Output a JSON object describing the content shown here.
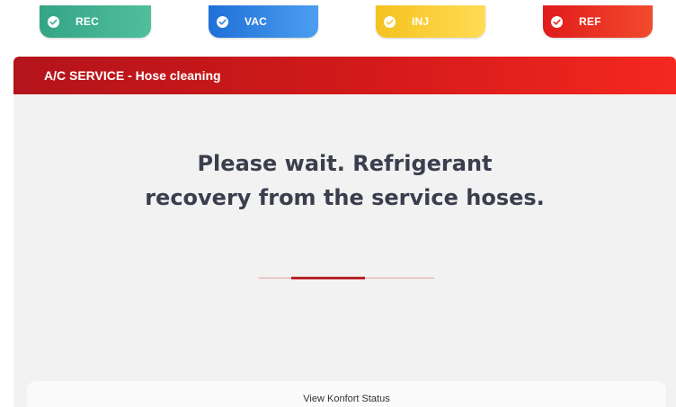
{
  "steps": [
    {
      "id": "rec",
      "label": "REC",
      "status": "completed",
      "color": "#3fae8e"
    },
    {
      "id": "vac",
      "label": "VAC",
      "status": "completed",
      "color": "#2f86e6"
    },
    {
      "id": "inj",
      "label": "INJ",
      "status": "completed",
      "color": "#f7cc33"
    },
    {
      "id": "ref",
      "label": "REF",
      "status": "completed",
      "color": "#e8271f"
    }
  ],
  "panel": {
    "title": "A/C SERVICE - Hose cleaning",
    "message_line1": "Please wait. Refrigerant",
    "message_line2": "recovery from the service hoses.",
    "progress": {
      "state": "indeterminate",
      "color": "#b8232a"
    }
  },
  "footer": {
    "status_link": "View Konfort Status"
  },
  "colors": {
    "header_red": "#d41a1a",
    "panel_bg": "#f2f2f2",
    "text_dark": "#3a3e4d"
  }
}
